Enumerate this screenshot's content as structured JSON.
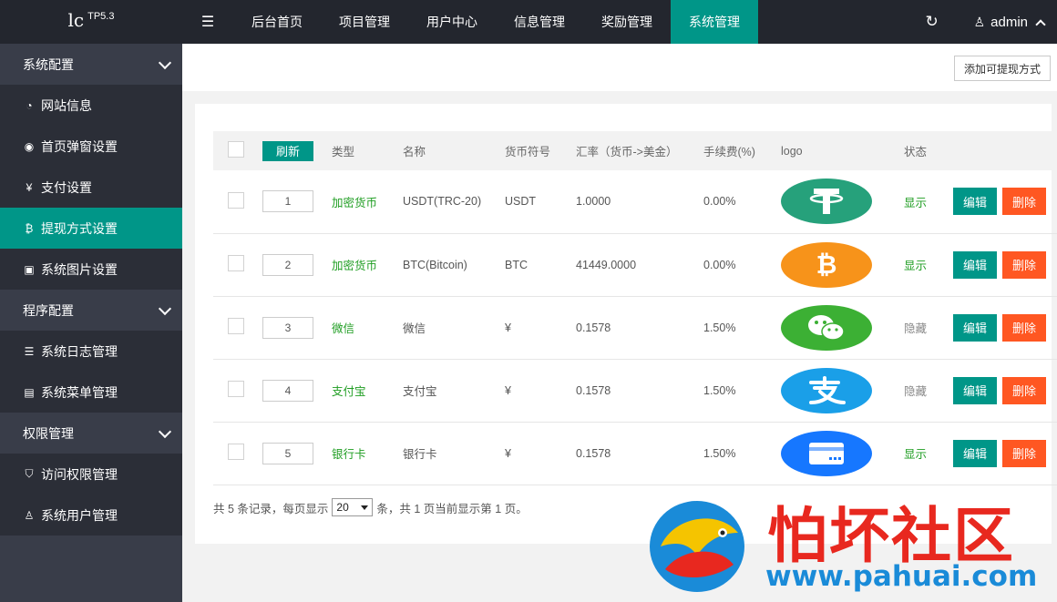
{
  "logo": {
    "main": "lc",
    "version": "TP5.3"
  },
  "topbar": {
    "tabs": [
      "后台首页",
      "项目管理",
      "用户中心",
      "信息管理",
      "奖励管理",
      "系统管理"
    ],
    "active_tab": "系统管理",
    "user": "admin"
  },
  "sidebar": {
    "groups": [
      {
        "label": "系统配置",
        "items": [
          "网站信息",
          "首页弹窗设置",
          "支付设置",
          "提现方式设置",
          "系统图片设置"
        ]
      },
      {
        "label": "程序配置",
        "items": [
          "系统日志管理",
          "系统菜单管理"
        ]
      },
      {
        "label": "权限管理",
        "items": [
          "访问权限管理",
          "系统用户管理"
        ]
      }
    ],
    "active_item": "提现方式设置"
  },
  "toolbar": {
    "add_label": "添加可提现方式"
  },
  "table": {
    "refresh_label": "刷新",
    "headers": [
      "类型",
      "名称",
      "货币符号",
      "汇率（货币->美金）",
      "手续费(%)",
      "logo",
      "状态"
    ],
    "rows": [
      {
        "sort": "1",
        "type": "加密货币",
        "name": "USDT(TRC-20)",
        "symbol": "USDT",
        "rate": "1.0000",
        "fee": "0.00%",
        "logo": "tether-icon",
        "logo_color": "#26a17b",
        "status": "显示"
      },
      {
        "sort": "2",
        "type": "加密货币",
        "name": "BTC(Bitcoin)",
        "symbol": "BTC",
        "rate": "41449.0000",
        "fee": "0.00%",
        "logo": "bitcoin-icon",
        "logo_color": "#f7931a",
        "status": "显示"
      },
      {
        "sort": "3",
        "type": "微信",
        "name": "微信",
        "symbol": "¥",
        "rate": "0.1578",
        "fee": "1.50%",
        "logo": "wechat-icon",
        "logo_color": "#3cb034",
        "status": "隐藏"
      },
      {
        "sort": "4",
        "type": "支付宝",
        "name": "支付宝",
        "symbol": "¥",
        "rate": "0.1578",
        "fee": "1.50%",
        "logo": "alipay-icon",
        "logo_color": "#1a9fe8",
        "status": "隐藏"
      },
      {
        "sort": "5",
        "type": "银行卡",
        "name": "银行卡",
        "symbol": "¥",
        "rate": "0.1578",
        "fee": "1.50%",
        "logo": "bank-card-icon",
        "logo_color": "#1677ff",
        "status": "显示"
      }
    ],
    "edit_label": "编辑",
    "delete_label": "删除"
  },
  "pager": {
    "text_before": "共 5 条记录，每页显示",
    "per_page": "20",
    "text_after": "条，共 1 页当前显示第 1 页。"
  },
  "watermark": {
    "title": "怕坏社区",
    "url": "www.pahuai.com"
  }
}
